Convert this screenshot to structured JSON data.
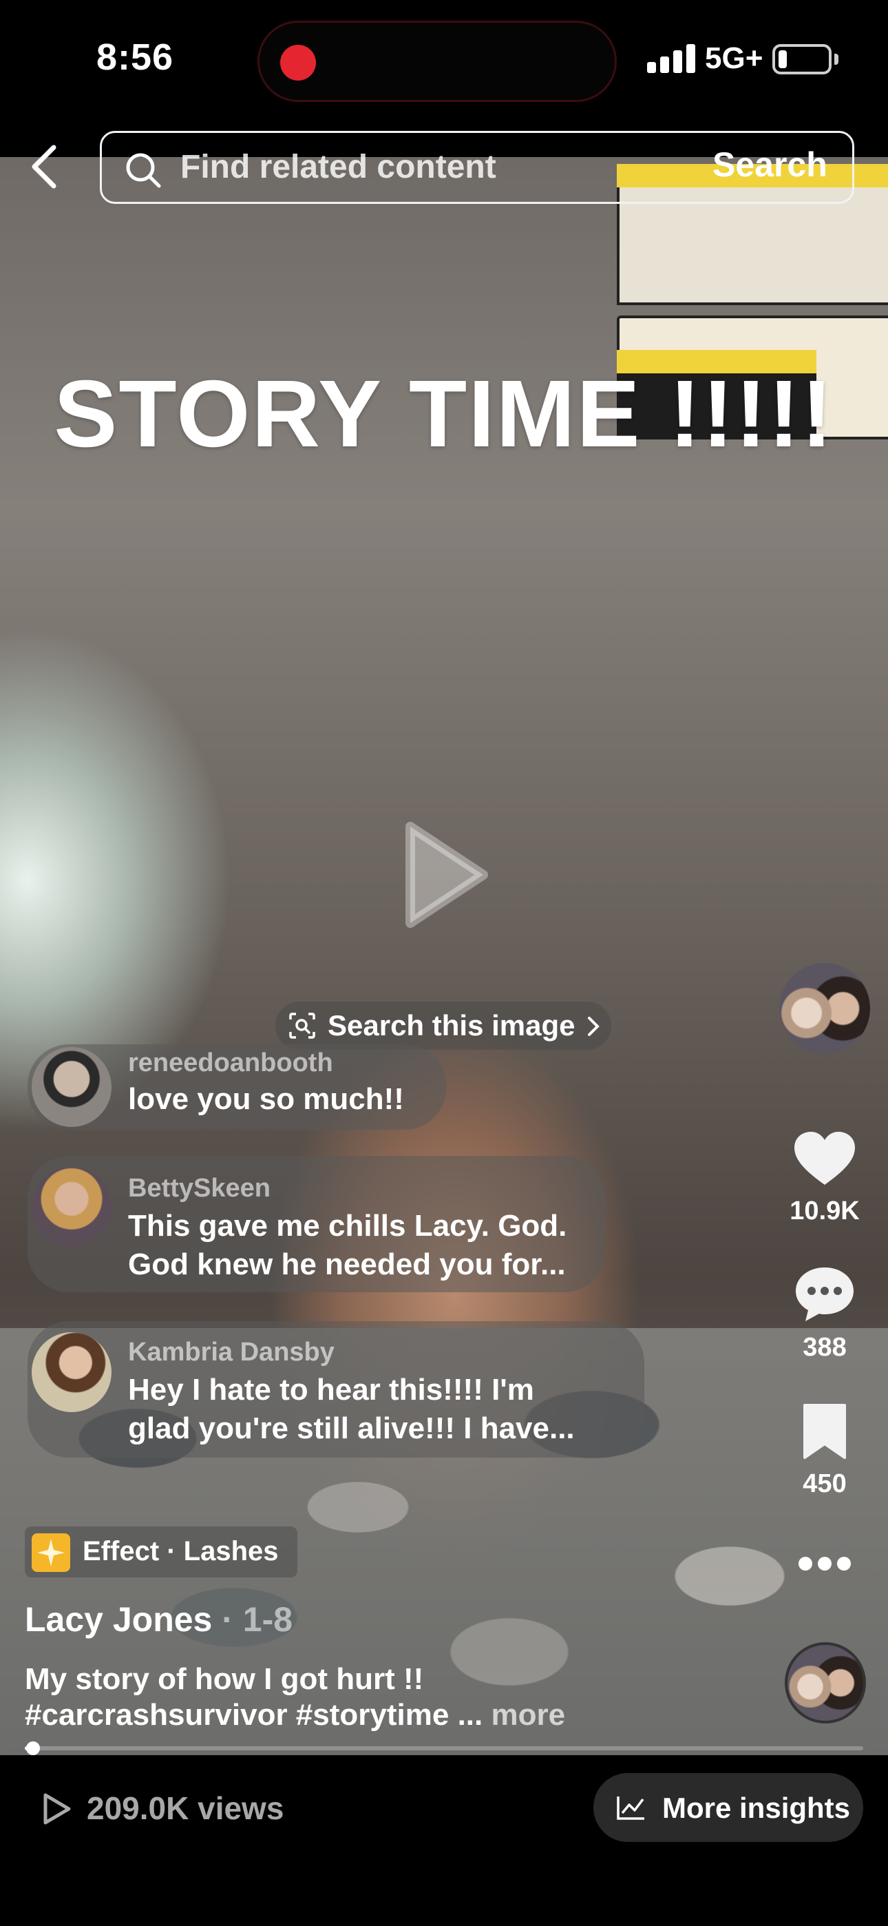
{
  "status_bar": {
    "time": "8:56",
    "network": "5G+",
    "battery_level": 0.1
  },
  "search": {
    "placeholder": "Find related content",
    "button_label": "Search"
  },
  "video": {
    "overlay_text": "STORY TIME !!!!!",
    "search_image_label": "Search this image"
  },
  "comments": [
    {
      "username": "reneedoanbooth",
      "text_lines": [
        "love you so much!!"
      ]
    },
    {
      "username": "BettySkeen",
      "text_lines": [
        "This gave me chills Lacy. God.",
        "God knew he needed you for..."
      ]
    },
    {
      "username": "Kambria Dansby",
      "text_lines": [
        "Hey I hate to hear this!!!! I'm",
        "glad you're still alive!!! I have..."
      ]
    }
  ],
  "actions": {
    "likes": "10.9K",
    "comments": "388",
    "saves": "450"
  },
  "post": {
    "effect_label": "Effect · Lashes",
    "creator_name": "Lacy Jones",
    "date": " · 1-8",
    "caption_line1": "My story of how I got hurt !!",
    "caption_line2": "#carcrashsurvivor #storytime ... ",
    "more_label": "more",
    "progress": 0.01
  },
  "bottom_bar": {
    "views": "209.0K views",
    "insights_label": "More insights"
  },
  "colors": {
    "recording_dot": "#e3262f",
    "effect_icon": "#f5b62a",
    "background": "#000000"
  },
  "icons": [
    "back-chevron-icon",
    "search-icon",
    "play-icon",
    "image-search-icon",
    "heart-icon",
    "comment-bubble-icon",
    "bookmark-icon",
    "more-dots-icon",
    "views-play-icon",
    "insights-chart-icon"
  ]
}
